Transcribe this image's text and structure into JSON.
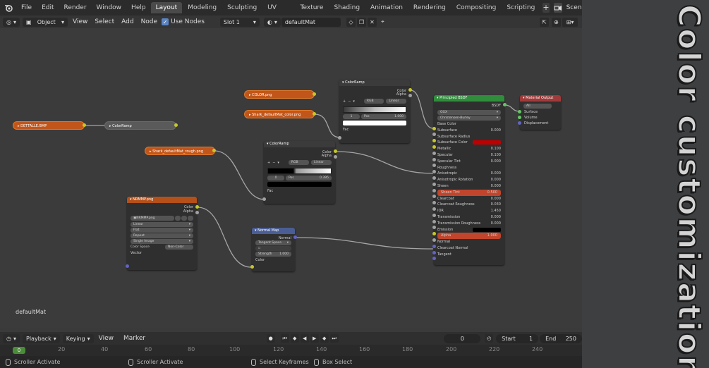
{
  "menu": {
    "items": [
      "File",
      "Edit",
      "Render",
      "Window",
      "Help"
    ]
  },
  "workspaces": {
    "tabs": [
      "Layout",
      "Modeling",
      "Sculpting",
      "UV Editing",
      "Texture Paint",
      "Shading",
      "Animation",
      "Rendering",
      "Compositing",
      "Scripting"
    ],
    "active": "Layout",
    "scene": "Scene"
  },
  "header": {
    "mode": "Object",
    "view": "View",
    "select": "Select",
    "add": "Add",
    "node": "Node",
    "use_nodes": "Use Nodes",
    "slot": "Slot 1",
    "material": "defaultMat"
  },
  "nodes": {
    "dettagli": "DETTALLE.BMP",
    "colorramp_small": "ColorRamp",
    "color_png": "COLOR.png",
    "shark_color": "Shark_defaultMat_color.png",
    "shark_rough": "Shark_defaultMat_rough.png",
    "colorramp1": {
      "title": "ColorRamp",
      "out_color": "Color",
      "out_alpha": "Alpha",
      "mode": "RGB",
      "interp": "Linear",
      "index": "1",
      "pos_label": "Pos",
      "pos": "1.000",
      "fac": "Fac"
    },
    "colorramp2": {
      "title": "ColorRamp",
      "out_color": "Color",
      "out_alpha": "Alpha",
      "mode": "RGB",
      "interp": "Linear",
      "index": "0",
      "pos_label": "Pos",
      "pos": "0.395",
      "fac": "Fac"
    },
    "normal_tex": {
      "title": "NRMMP.png",
      "out_color": "Color",
      "out_alpha": "Alpha",
      "file": "NRMMP.png",
      "interp": "Linear",
      "proj": "Flat",
      "ext": "Repeat",
      "src": "Single Image",
      "cs_label": "Color Space",
      "cs_value": "Non-Color",
      "vector": "Vector"
    },
    "normal_map": {
      "title": "Normal Map",
      "out_normal": "Normal",
      "space": "Tangent Space",
      "strength_label": "Strength",
      "strength": "1.000",
      "in_color": "Color"
    },
    "bsdf": {
      "title": "Principled BSDF",
      "out": "BSDF",
      "dist": "GGX",
      "sss": "Christensen-Burley",
      "rows": [
        {
          "label": "Base Color",
          "value": ""
        },
        {
          "label": "Subsurface",
          "value": "0.000"
        },
        {
          "label": "Subsurface Radius",
          "value": ""
        },
        {
          "label": "Subsurface Color",
          "value": ""
        },
        {
          "label": "Metallic",
          "value": "0.100"
        },
        {
          "label": "Specular",
          "value": "0.100"
        },
        {
          "label": "Specular Tint",
          "value": "0.000"
        },
        {
          "label": "Roughness",
          "value": ""
        },
        {
          "label": "Anisotropic",
          "value": "0.000"
        },
        {
          "label": "Anisotropic Rotation",
          "value": "0.000"
        },
        {
          "label": "Sheen",
          "value": "0.000"
        },
        {
          "label": "Sheen Tint",
          "value": "0.500"
        },
        {
          "label": "Clearcoat",
          "value": "0.000"
        },
        {
          "label": "Clearcoat Roughness",
          "value": "0.030"
        },
        {
          "label": "IOR",
          "value": "1.450"
        },
        {
          "label": "Transmission",
          "value": "0.000"
        },
        {
          "label": "Transmission Roughness",
          "value": "0.000"
        },
        {
          "label": "Emission",
          "value": ""
        },
        {
          "label": "Alpha",
          "value": "1.000"
        },
        {
          "label": "Normal",
          "value": ""
        },
        {
          "label": "Clearcoat Normal",
          "value": ""
        },
        {
          "label": "Tangent",
          "value": ""
        }
      ]
    },
    "output": {
      "title": "Material Output",
      "target": "All",
      "surface": "Surface",
      "volume": "Volume",
      "displacement": "Displacement"
    }
  },
  "canvas_label": "defaultMat",
  "timeline": {
    "playback": "Playback",
    "keying": "Keying",
    "view": "View",
    "marker": "Marker",
    "current": "0",
    "start_label": "Start",
    "start": "1",
    "end_label": "End",
    "end": "250",
    "ruler_current": "0",
    "ticks": [
      "20",
      "40",
      "60",
      "80",
      "100",
      "120",
      "140",
      "160",
      "180",
      "200",
      "220",
      "240"
    ]
  },
  "status": {
    "item1": "Scroller Activate",
    "item2": "Scroller Activate",
    "item3": "Select Keyframes",
    "item4": "Box Select"
  },
  "title_panel": {
    "text": "Color customization"
  }
}
